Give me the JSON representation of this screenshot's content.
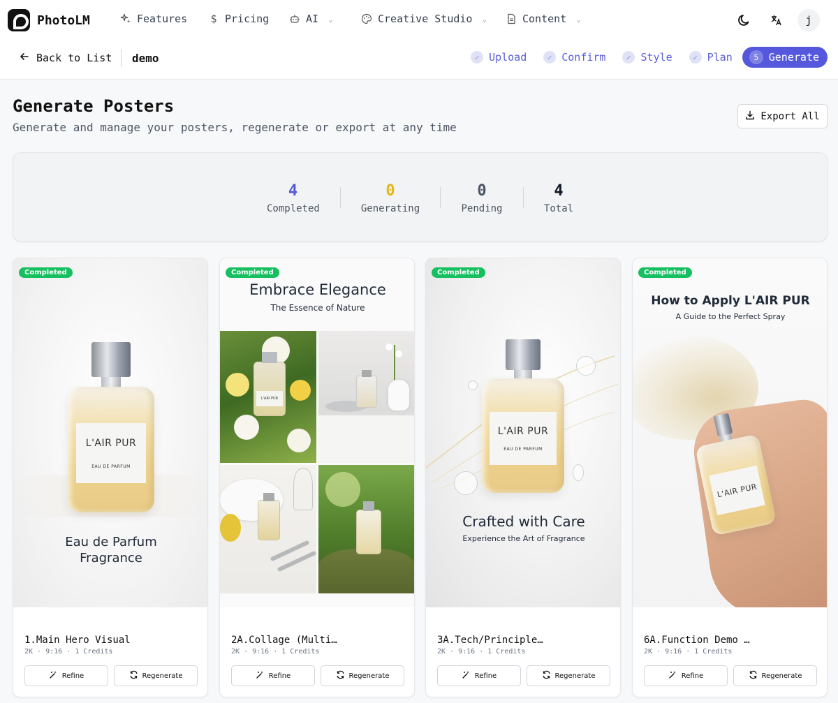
{
  "nav": {
    "logo": "PhotoLM",
    "items": [
      {
        "label": "Features",
        "icon": "sparkles-icon"
      },
      {
        "label": "Pricing",
        "icon": "dollar-icon"
      },
      {
        "label": "AI",
        "icon": "robot-icon"
      },
      {
        "label": "Creative Studio",
        "icon": "palette-icon"
      },
      {
        "label": "Content",
        "icon": "document-icon"
      }
    ],
    "avatar": "j"
  },
  "subheader": {
    "back_label": "Back to List",
    "project_name": "demo",
    "steps": [
      {
        "label": "Upload",
        "status": "done"
      },
      {
        "label": "Confirm",
        "status": "done"
      },
      {
        "label": "Style",
        "status": "done"
      },
      {
        "label": "Plan",
        "status": "done"
      },
      {
        "label": "Generate",
        "status": "active",
        "number": "5"
      }
    ]
  },
  "page": {
    "title": "Generate Posters",
    "subtitle": "Generate and manage your posters, regenerate or export at any time",
    "export_label": "Export All"
  },
  "stats": [
    {
      "value": "4",
      "label": "Completed",
      "color": "#5558dd"
    },
    {
      "value": "0",
      "label": "Generating",
      "color": "#e5b81c"
    },
    {
      "value": "0",
      "label": "Pending",
      "color": "#4b5563"
    },
    {
      "value": "4",
      "label": "Total",
      "color": "#111827"
    }
  ],
  "cards": [
    {
      "badge": "Completed",
      "title": "1.Main Hero Visual",
      "meta": "2K · 9:16 · 1 Credits",
      "poster": {
        "headline": "Eau de Parfum",
        "headline2": "Fragrance",
        "brand": "L'AIR PUR",
        "brand_sub": "EAU DE PARFUM"
      },
      "refine_label": "Refine",
      "regen_label": "Regenerate"
    },
    {
      "badge": "Completed",
      "title": "2A.Collage (Multi…",
      "meta": "2K · 9:16 · 1 Credits",
      "poster": {
        "headline": "Embrace Elegance",
        "subheadline": "The Essence of Nature",
        "brand": "L'AIR PUR"
      },
      "refine_label": "Refine",
      "regen_label": "Regenerate"
    },
    {
      "badge": "Completed",
      "title": "3A.Tech/Principle…",
      "meta": "2K · 9:16 · 1 Credits",
      "poster": {
        "headline": "Crafted with Care",
        "subheadline": "Experience the Art of Fragrance",
        "brand": "L'AIR PUR",
        "brand_sub": "EAU DE PARFUM"
      },
      "refine_label": "Refine",
      "regen_label": "Regenerate"
    },
    {
      "badge": "Completed",
      "title": "6A.Function Demo …",
      "meta": "2K · 9:16 · 1 Credits",
      "poster": {
        "headline": "How to Apply L'AIR PUR",
        "subheadline": "A Guide to the Perfect Spray",
        "brand": "L'AIR PUR"
      },
      "refine_label": "Refine",
      "regen_label": "Regenerate"
    }
  ]
}
